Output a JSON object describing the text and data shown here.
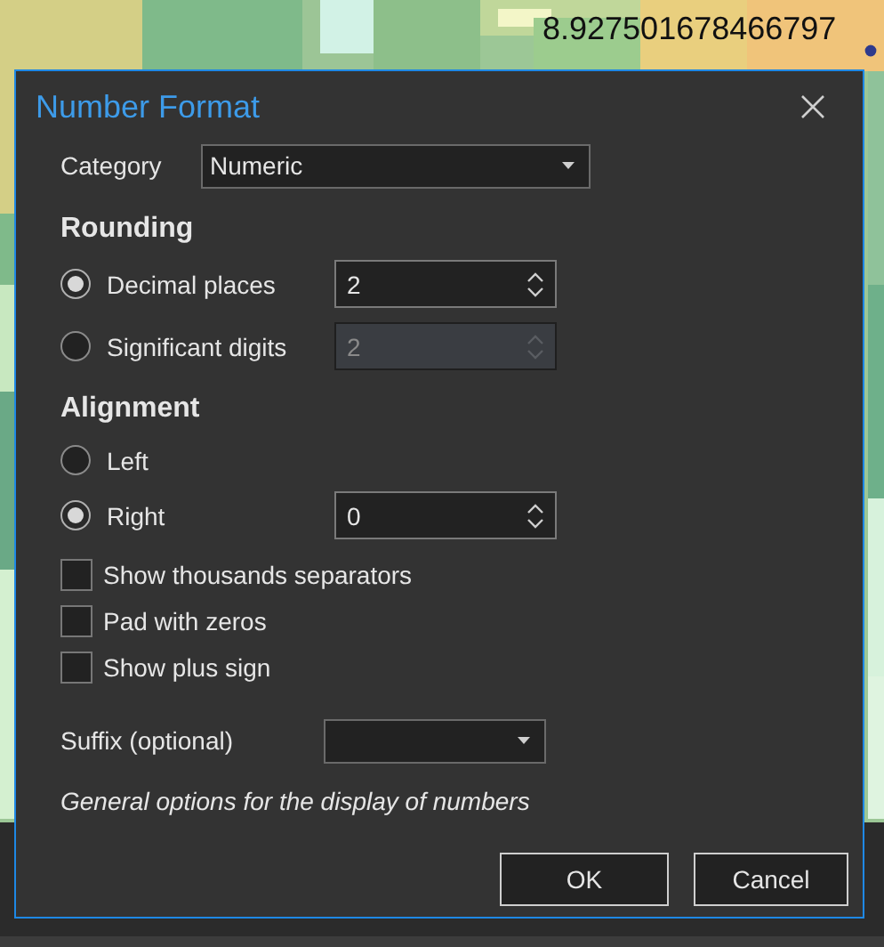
{
  "map": {
    "label": "8.927501678466797"
  },
  "dialog": {
    "title": "Number Format",
    "category": {
      "label": "Category",
      "value": "Numeric"
    },
    "rounding": {
      "heading": "Rounding",
      "options": [
        {
          "label": "Decimal places",
          "selected": true,
          "value": "2",
          "disabled": false
        },
        {
          "label": "Significant digits",
          "selected": false,
          "value": "2",
          "disabled": true
        }
      ]
    },
    "alignment": {
      "heading": "Alignment",
      "options": [
        {
          "label": "Left",
          "selected": false
        },
        {
          "label": "Right",
          "selected": true,
          "value": "0",
          "disabled": false
        }
      ]
    },
    "checkboxes": [
      {
        "label": "Show thousands separators",
        "checked": false
      },
      {
        "label": "Pad with zeros",
        "checked": false
      },
      {
        "label": "Show plus sign",
        "checked": false
      }
    ],
    "suffix": {
      "label": "Suffix (optional)"
    },
    "note": "General options for the display of numbers",
    "buttons": [
      "OK",
      "Cancel"
    ]
  }
}
